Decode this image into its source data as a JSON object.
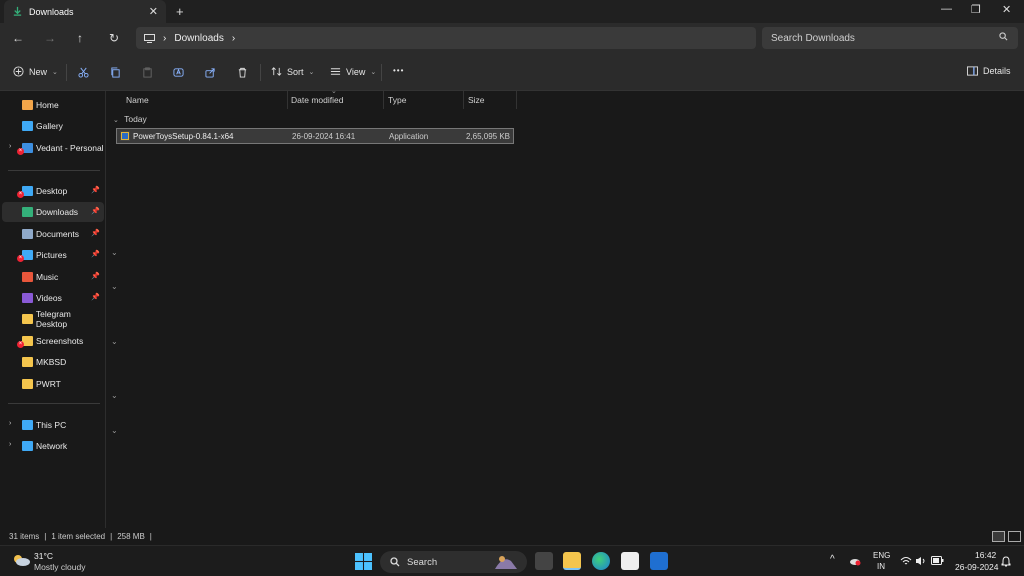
{
  "tab": {
    "title": "Downloads",
    "close": "✕",
    "new": "+"
  },
  "window_controls": {
    "minimize": "—",
    "restore": "❐",
    "close": "✕"
  },
  "nav": {
    "back": "←",
    "forward": "→",
    "up": "↑",
    "refresh": "↻"
  },
  "address": {
    "monitor": "🖵",
    "sep1": "›",
    "folder": "Downloads",
    "sep2": "›"
  },
  "search": {
    "placeholder": "Search Downloads"
  },
  "commands": {
    "new": "New",
    "sort": "Sort",
    "view": "View",
    "more": "•••",
    "details": "Details",
    "caret": "⌄"
  },
  "sidebar": {
    "groups": [
      [
        {
          "label": "Home",
          "icon": "home-icon",
          "color": "#f2a54a",
          "selected": false,
          "pinned": false,
          "expand": false,
          "error": false
        },
        {
          "label": "Gallery",
          "icon": "gallery-icon",
          "color": "#3fa9f5",
          "selected": false,
          "pinned": false,
          "expand": false,
          "error": false
        },
        {
          "label": "Vedant - Personal",
          "icon": "cloud-icon",
          "color": "#3d8fe0",
          "selected": false,
          "pinned": false,
          "expand": true,
          "error": true
        }
      ],
      [
        {
          "label": "Desktop",
          "icon": "desktop-icon",
          "color": "#3fa9f5",
          "selected": false,
          "pinned": true,
          "expand": false,
          "error": true
        },
        {
          "label": "Downloads",
          "icon": "download-icon",
          "color": "#34b07a",
          "selected": true,
          "pinned": true,
          "expand": false,
          "error": false
        },
        {
          "label": "Documents",
          "icon": "documents-icon",
          "color": "#8fa9c9",
          "selected": false,
          "pinned": true,
          "expand": false,
          "error": false
        },
        {
          "label": "Pictures",
          "icon": "pictures-icon",
          "color": "#3fa9f5",
          "selected": false,
          "pinned": true,
          "expand": false,
          "error": true
        },
        {
          "label": "Music",
          "icon": "music-icon",
          "color": "#e8563b",
          "selected": false,
          "pinned": true,
          "expand": false,
          "error": false
        },
        {
          "label": "Videos",
          "icon": "videos-icon",
          "color": "#8a5ad6",
          "selected": false,
          "pinned": true,
          "expand": false,
          "error": false
        },
        {
          "label": "Telegram Desktop",
          "icon": "folder-icon",
          "color": "#f4c54d",
          "selected": false,
          "pinned": false,
          "expand": false,
          "error": false
        },
        {
          "label": "Screenshots",
          "icon": "folder-icon",
          "color": "#f4c54d",
          "selected": false,
          "pinned": false,
          "expand": false,
          "error": true
        },
        {
          "label": "MKBSD",
          "icon": "folder-icon",
          "color": "#f4c54d",
          "selected": false,
          "pinned": false,
          "expand": false,
          "error": false
        },
        {
          "label": "PWRT",
          "icon": "folder-icon",
          "color": "#f4c54d",
          "selected": false,
          "pinned": false,
          "expand": false,
          "error": false
        }
      ],
      [
        {
          "label": "This PC",
          "icon": "pc-icon",
          "color": "#3fa9f5",
          "selected": false,
          "pinned": false,
          "expand": true,
          "error": false
        },
        {
          "label": "Network",
          "icon": "network-icon",
          "color": "#3fa9f5",
          "selected": false,
          "pinned": false,
          "expand": true,
          "error": false
        }
      ]
    ]
  },
  "columns": {
    "name": "Name",
    "date": "Date modified",
    "type": "Type",
    "size": "Size"
  },
  "group_label": "Today",
  "files": [
    {
      "name": "PowerToysSetup-0.84.1-x64",
      "date": "26-09-2024 16:41",
      "type": "Application",
      "size": "2,65,095 KB"
    }
  ],
  "status": {
    "items": "31 items",
    "selected": "1 item selected",
    "size": "258 MB",
    "bar": "|"
  },
  "taskbar": {
    "temp": "31°C",
    "weather": "Mostly cloudy",
    "search": "Search",
    "lang1": "ENG",
    "lang2": "IN",
    "time": "16:42",
    "date": "26-09-2024",
    "chevron_up": "^"
  }
}
